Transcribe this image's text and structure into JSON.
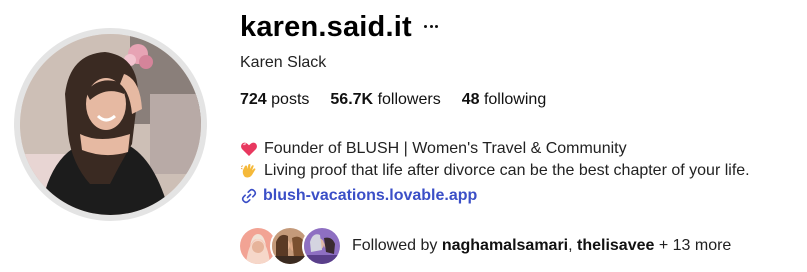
{
  "profile": {
    "username": "karen.said.it",
    "full_name": "Karen Slack",
    "stats": {
      "posts_count": "724",
      "posts_label": "posts",
      "followers_count": "56.7K",
      "followers_label": "followers",
      "following_count": "48",
      "following_label": "following"
    },
    "bio": [
      {
        "icon": "heart-icon",
        "text": "Founder of BLUSH | Women's Travel & Community"
      },
      {
        "icon": "waving-hand-icon",
        "text": "Living proof that life after divorce can be the best chapter of your life."
      }
    ],
    "link": {
      "icon": "link-icon",
      "text": "blush-vacations.lovable.app"
    },
    "followed_by": {
      "prefix": "Followed by ",
      "user1": "naghamalsamari",
      "separator": ", ",
      "user2": "thelisavee",
      "suffix": " + 13 more"
    }
  },
  "colors": {
    "link": "#3b4fc7",
    "heart": "#e8385f",
    "avatar_ring": "#e4e4e4"
  }
}
